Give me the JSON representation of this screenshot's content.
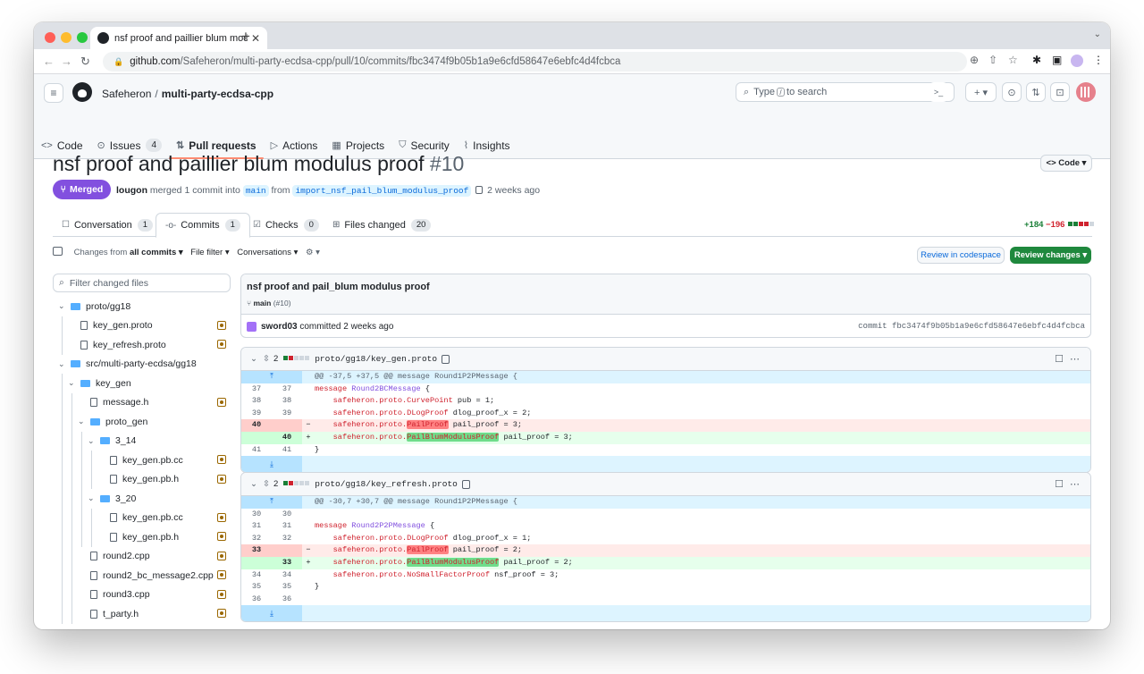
{
  "browser": {
    "tab_title": "nsf proof and paillier blum mod",
    "url_host": "github.com",
    "url_path": "/Safeheron/multi-party-ecdsa-cpp/pull/10/commits/fbc3474f9b05b1a9e6cfd58647e6ebfc4d4fcbca"
  },
  "header": {
    "owner": "Safeheron",
    "separator": "/",
    "repo": "multi-party-ecdsa-cpp",
    "search_prefix": "Type",
    "search_key": "/",
    "search_suffix": "to search",
    "terminal_icon": ">_",
    "plus_label": "+ ▾"
  },
  "repo_tabs": [
    {
      "label": "Code",
      "icon": "<>"
    },
    {
      "label": "Issues",
      "icon": "⊙",
      "count": "4"
    },
    {
      "label": "Pull requests",
      "icon": "⇅"
    },
    {
      "label": "Actions",
      "icon": "▷"
    },
    {
      "label": "Projects",
      "icon": "▦"
    },
    {
      "label": "Security",
      "icon": "⛉"
    },
    {
      "label": "Insights",
      "icon": "⌇"
    }
  ],
  "pr": {
    "title": "nsf proof and paillier blum modulus proof",
    "number": "#10",
    "code_button": "<> Code ▾",
    "state": "Merged",
    "author": "lougon",
    "merged_text": "merged 1 commit into",
    "base": "main",
    "from_text": "from",
    "head": "import_nsf_pail_blum_modulus_proof",
    "time": "2 weeks ago"
  },
  "pr_tabs": [
    {
      "label": "Conversation",
      "count": "1"
    },
    {
      "label": "Commits",
      "count": "1"
    },
    {
      "label": "Checks",
      "count": "0"
    },
    {
      "label": "Files changed",
      "count": "20"
    }
  ],
  "diffstat": {
    "additions": "+184",
    "deletions": "−196"
  },
  "toolbar": {
    "changes_from": "Changes from",
    "all_commits": "all commits ▾",
    "file_filter": "File filter ▾",
    "conversations": "Conversations ▾",
    "settings": "⚙ ▾",
    "review_codespace": "Review in codespace",
    "review_changes": "Review changes ▾"
  },
  "sidebar": {
    "filter_placeholder": "Filter changed files",
    "tree": [
      {
        "label": "proto/gg18",
        "type": "folder",
        "level": 0
      },
      {
        "label": "key_gen.proto",
        "type": "file",
        "level": 1
      },
      {
        "label": "key_refresh.proto",
        "type": "file",
        "level": 1
      },
      {
        "label": "src/multi-party-ecdsa/gg18",
        "type": "folder",
        "level": 0
      },
      {
        "label": "key_gen",
        "type": "folder",
        "level": 1
      },
      {
        "label": "message.h",
        "type": "file",
        "level": 2
      },
      {
        "label": "proto_gen",
        "type": "folder",
        "level": 2
      },
      {
        "label": "3_14",
        "type": "folder",
        "level": 3
      },
      {
        "label": "key_gen.pb.cc",
        "type": "file",
        "level": 4
      },
      {
        "label": "key_gen.pb.h",
        "type": "file",
        "level": 4
      },
      {
        "label": "3_20",
        "type": "folder",
        "level": 3
      },
      {
        "label": "key_gen.pb.cc",
        "type": "file",
        "level": 4
      },
      {
        "label": "key_gen.pb.h",
        "type": "file",
        "level": 4
      },
      {
        "label": "round2.cpp",
        "type": "file",
        "level": 2
      },
      {
        "label": "round2_bc_message2.cpp",
        "type": "file",
        "level": 2
      },
      {
        "label": "round3.cpp",
        "type": "file",
        "level": 2
      },
      {
        "label": "t_party.h",
        "type": "file",
        "level": 2
      }
    ]
  },
  "commit": {
    "message": "nsf proof and pail_blum modulus proof",
    "branch": "main",
    "branch_ref": "(#10)",
    "author": "sword03",
    "committed_text": "committed 2 weeks ago",
    "sha_label": "commit fbc3474f9b05b1a9e6cfd58647e6ebfc4d4fcbca"
  },
  "files": [
    {
      "changes": "2",
      "path": "proto/gg18/key_gen.proto",
      "hunk": "@@ -37,5 +37,5 @@ message Round1P2PMessage {",
      "lines": [
        {
          "t": "ctx",
          "o": "37",
          "n": "37",
          "c": "message Round2BCMessage {"
        },
        {
          "t": "ctx",
          "o": "38",
          "n": "38",
          "c": "    safeheron.proto.CurvePoint pub = 1;"
        },
        {
          "t": "ctx",
          "o": "39",
          "n": "39",
          "c": "    safeheron.proto.DLogProof dlog_proof_x = 2;"
        },
        {
          "t": "del",
          "o": "40",
          "n": "",
          "c": "    safeheron.proto.PailProof pail_proof = 3;"
        },
        {
          "t": "add",
          "o": "",
          "n": "40",
          "c": "    safeheron.proto.PailBlumModulusProof pail_proof = 3;"
        },
        {
          "t": "ctx",
          "o": "41",
          "n": "41",
          "c": "}"
        }
      ]
    },
    {
      "changes": "2",
      "path": "proto/gg18/key_refresh.proto",
      "hunk": "@@ -30,7 +30,7 @@ message Round1P2PMessage {",
      "lines": [
        {
          "t": "ctx",
          "o": "30",
          "n": "30",
          "c": ""
        },
        {
          "t": "ctx",
          "o": "31",
          "n": "31",
          "c": "message Round2P2PMessage {"
        },
        {
          "t": "ctx",
          "o": "32",
          "n": "32",
          "c": "    safeheron.proto.DLogProof dlog_proof_x = 1;"
        },
        {
          "t": "del",
          "o": "33",
          "n": "",
          "c": "    safeheron.proto.PailProof pail_proof = 2;"
        },
        {
          "t": "add",
          "o": "",
          "n": "33",
          "c": "    safeheron.proto.PailBlumModulusProof pail_proof = 2;"
        },
        {
          "t": "ctx",
          "o": "34",
          "n": "34",
          "c": "    safeheron.proto.NoSmallFactorProof nsf_proof = 3;"
        },
        {
          "t": "ctx",
          "o": "35",
          "n": "35",
          "c": "}"
        },
        {
          "t": "ctx",
          "o": "36",
          "n": "36",
          "c": ""
        }
      ]
    }
  ],
  "colors": {
    "merged": "#8250df",
    "accent": "#0969da",
    "primary_button": "#1f883d",
    "tab_underline": "#fd8c73"
  }
}
